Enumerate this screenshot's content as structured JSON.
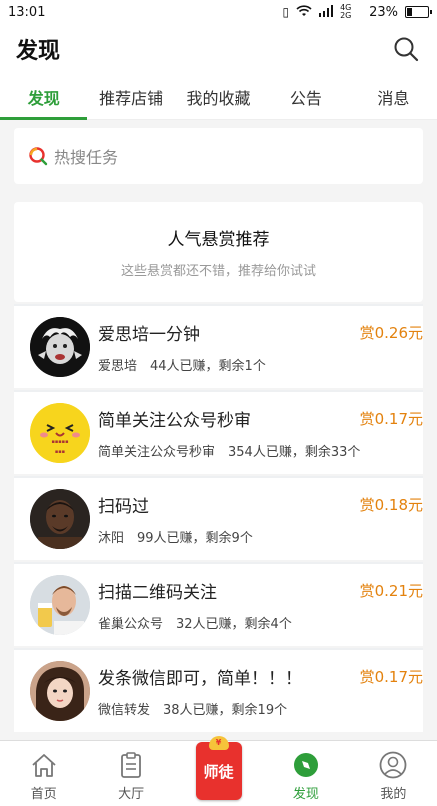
{
  "status": {
    "time": "13:01",
    "network": "4G 2G",
    "battery": "23%",
    "battery_level": 0.23
  },
  "header": {
    "title": "发现"
  },
  "tabs": [
    {
      "label": "发现",
      "active": true
    },
    {
      "label": "推荐店铺",
      "active": false
    },
    {
      "label": "我的收藏",
      "active": false
    },
    {
      "label": "公告",
      "active": false
    },
    {
      "label": "消息",
      "active": false
    }
  ],
  "search": {
    "placeholder": "热搜任务"
  },
  "recommend": {
    "title": "人气悬赏推荐",
    "subtitle": "这些悬赏都还不错，推荐给你试试"
  },
  "tasks": [
    {
      "name": "爱思培一分钟",
      "meta": "爱思培　44人已赚，剩余1个",
      "reward": "赏0.26元",
      "avatar": "einstein-avatar"
    },
    {
      "name": "简单关注公众号秒审",
      "meta": "简单关注公众号秒审　354人已赚，剩余33个",
      "reward": "赏0.17元",
      "avatar": "smiley-avatar"
    },
    {
      "name": "扫码过",
      "meta": "沐阳　99人已赚，剩余9个",
      "reward": "赏0.18元",
      "avatar": "man-avatar"
    },
    {
      "name": "扫描二维码关注",
      "meta": "雀巢公众号　32人已赚，剩余4个",
      "reward": "赏0.21元",
      "avatar": "beer-avatar"
    },
    {
      "name": "发条微信即可，简单！！！",
      "meta": "微信转发　38人已赚，剩余19个",
      "reward": "赏0.17元",
      "avatar": "girl-avatar"
    }
  ],
  "tabbar": {
    "home": "首页",
    "hall": "大厅",
    "master": "师徒",
    "discover": "发现",
    "mine": "我的"
  },
  "colors": {
    "accent": "#2e9e3a",
    "reward": "#e3820e",
    "master_red": "#e8312d"
  }
}
